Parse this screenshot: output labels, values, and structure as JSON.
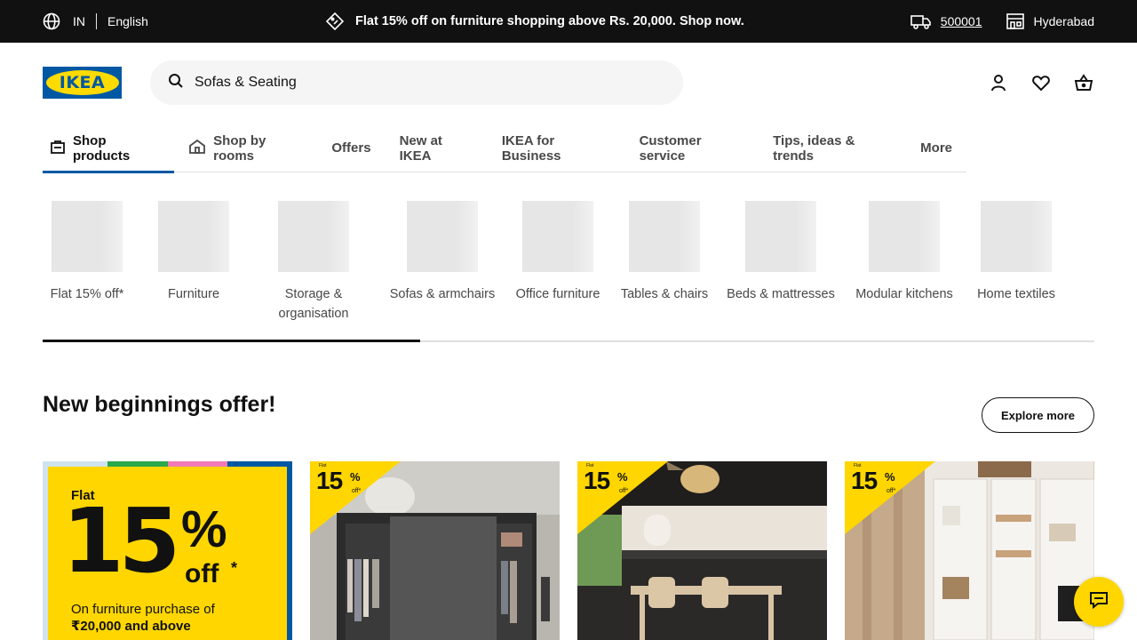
{
  "topbar": {
    "country": "IN",
    "language": "English",
    "promo": "Flat 15% off on furniture shopping above Rs. 20,000. Shop now.",
    "pincode": "500001",
    "store": "Hyderabad"
  },
  "header": {
    "logo_text": "IKEA",
    "search_value": "Sofas & Seating"
  },
  "nav": {
    "tabs": [
      {
        "label": "Shop products"
      },
      {
        "label": "Shop by rooms"
      },
      {
        "label": "Offers"
      },
      {
        "label": "New at IKEA"
      },
      {
        "label": "IKEA for Business"
      },
      {
        "label": "Customer service"
      },
      {
        "label": "Tips, ideas & trends"
      },
      {
        "label": "More"
      }
    ]
  },
  "categories": [
    {
      "label": "Flat 15% off*"
    },
    {
      "label": "Furniture"
    },
    {
      "label": "Storage & organisation"
    },
    {
      "label": "Sofas & armchairs"
    },
    {
      "label": "Office furniture"
    },
    {
      "label": "Tables & chairs"
    },
    {
      "label": "Beds & mattresses"
    },
    {
      "label": "Modular kitchens"
    },
    {
      "label": "Home textiles"
    }
  ],
  "section": {
    "title": "New beginnings offer!",
    "explore_label": "Explore more"
  },
  "offer_card": {
    "flat": "Flat",
    "number": "15",
    "percent": "%",
    "off": "off",
    "asterisk": "*",
    "line1": "On furniture purchase of",
    "line2": "₹20,000 and above"
  },
  "badge": {
    "flat": "Flat",
    "number": "15",
    "percent": "%",
    "off": "off*"
  },
  "colors": {
    "topbar_bg": "#111111",
    "ikea_blue": "#0058a3",
    "ikea_yellow": "#ffdb00",
    "nav_active_underline": "#0058a3"
  }
}
